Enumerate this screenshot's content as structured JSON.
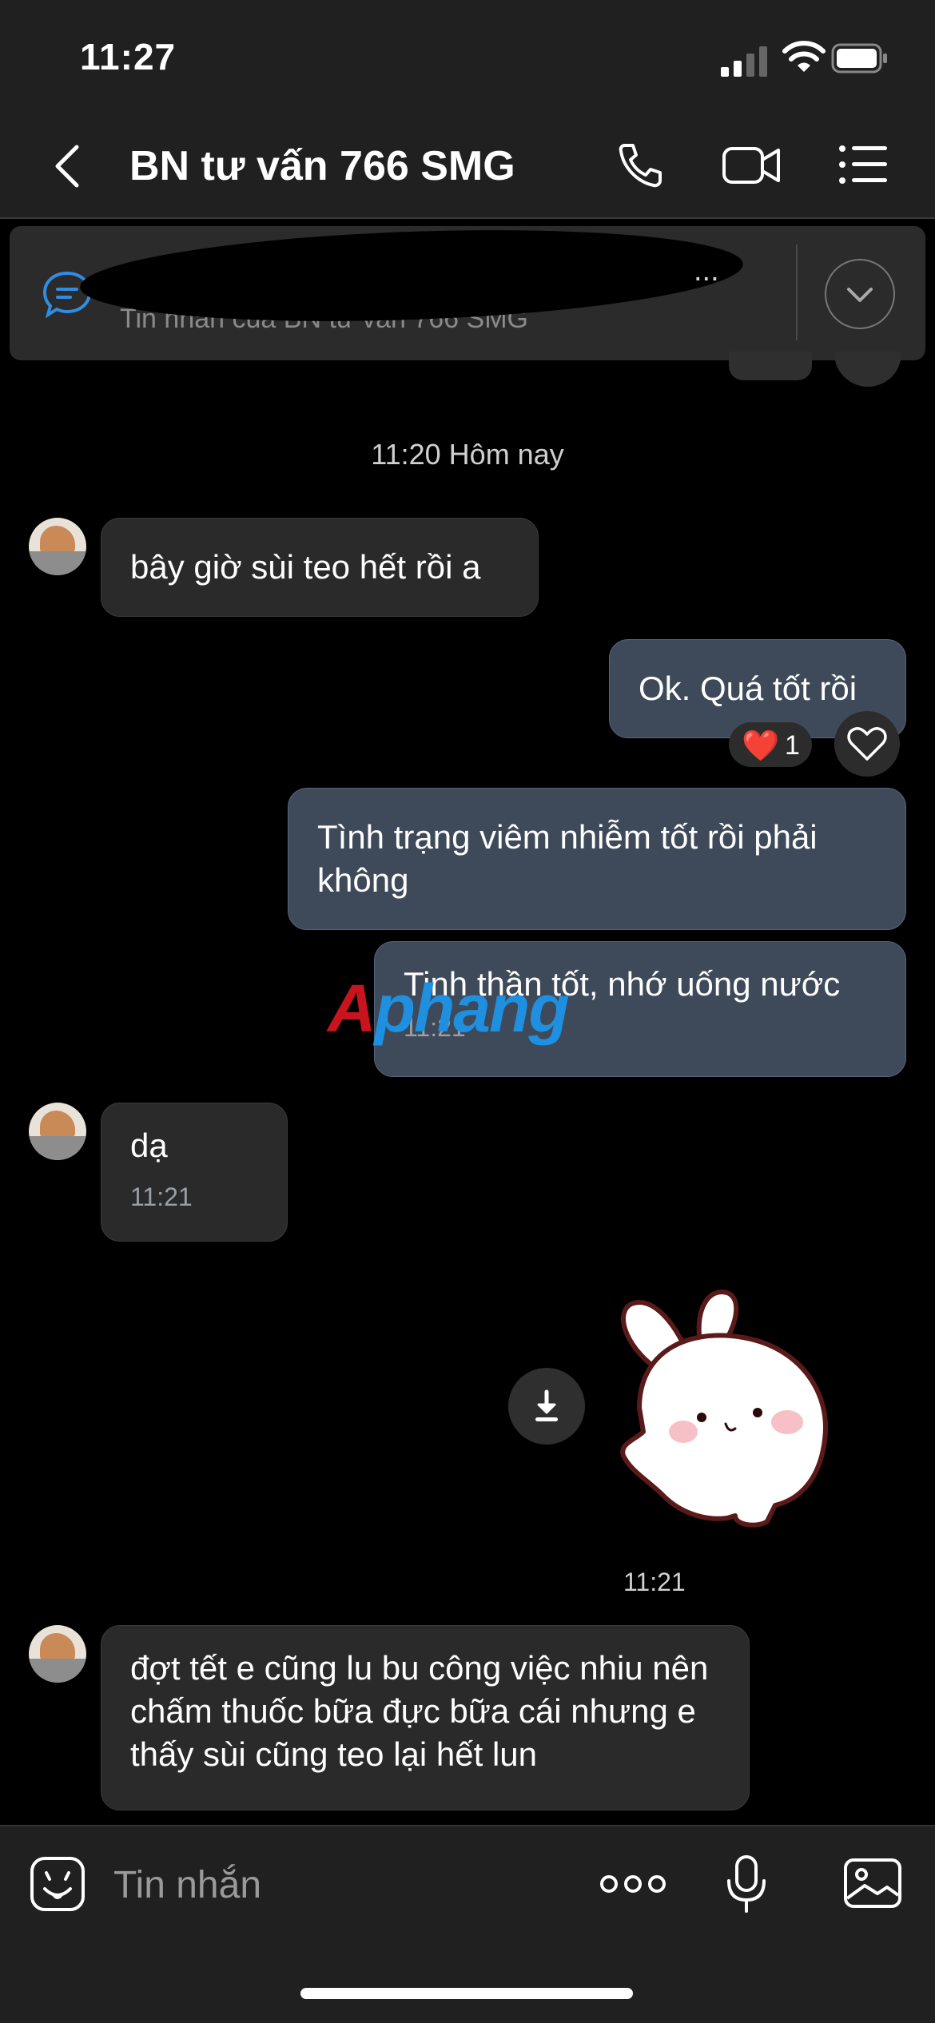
{
  "status_bar": {
    "time": "11:27",
    "icons": [
      "cellular-signal-icon",
      "wifi-icon",
      "battery-icon"
    ]
  },
  "header": {
    "title": "BN tư vấn 766 SMG",
    "icons": [
      "back-chevron-icon",
      "phone-icon",
      "video-call-icon",
      "menu-list-icon"
    ]
  },
  "pinned_message": {
    "preview_text": "...",
    "subtitle": "Tin nhắn của BN tư vấn 766 SMG",
    "icons": [
      "chat-bubble-icon",
      "chevron-down-icon"
    ]
  },
  "date_separator": "11:20 Hôm nay",
  "messages": [
    {
      "side": "received",
      "text": "bây giờ sùi teo hết rồi a"
    },
    {
      "side": "sent",
      "text": "Ok. Quá tốt rồi",
      "reaction": {
        "emoji": "❤️",
        "count": "1"
      }
    },
    {
      "side": "sent",
      "text": "Tình trạng viêm nhiễm tốt rồi phải không"
    },
    {
      "side": "sent",
      "text": "Tinh thần tốt, nhớ uống nước",
      "time": "11:21"
    },
    {
      "side": "received",
      "text": "dạ",
      "time": "11:21"
    },
    {
      "side": "sent",
      "type": "sticker",
      "description_icon": "bunny-sticker",
      "time": "11:21"
    },
    {
      "side": "received",
      "text": "đợt tết e cũng lu bu công việc nhiu nên chấm thuốc bữa đực bữa cái nhưng e thấy sùi cũng teo lại hết lun"
    }
  ],
  "watermark": {
    "part1": "A",
    "part2": "phang"
  },
  "composer": {
    "placeholder": "Tin nhắn",
    "icons": [
      "emoji-icon",
      "more-options-icon",
      "microphone-icon",
      "image-gallery-icon"
    ]
  },
  "colors": {
    "sent_bubble": "#3e4a5a",
    "received_bubble": "#2a2a2a",
    "accent": "#2f8de4",
    "heart": "#e8243a"
  }
}
